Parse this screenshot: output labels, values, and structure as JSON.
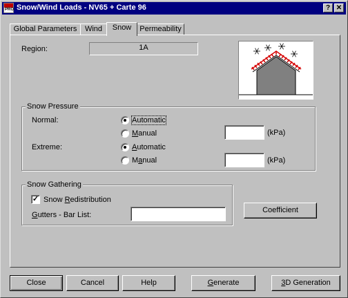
{
  "window": {
    "title": "Snow/Wind Loads - NV65 + Carte 96",
    "app_icon_text": "PRO",
    "help_btn": "?",
    "close_btn": "✕"
  },
  "tabs": [
    {
      "label": "Global Parameters",
      "active": false
    },
    {
      "label": "Wind",
      "active": false
    },
    {
      "label": "Snow",
      "active": true
    },
    {
      "label": "Permeability",
      "active": false
    }
  ],
  "region": {
    "label": "Region:",
    "value": "1A"
  },
  "illustration": {
    "icon": "snow-roof-illustration",
    "roof_color": "#d40000",
    "house_color": "#808080"
  },
  "snow_pressure": {
    "title": "Snow Pressure",
    "normal": {
      "label": "Normal:",
      "options": [
        "Automatic",
        "Manual"
      ],
      "selected": "Automatic",
      "value": "",
      "unit": "(kPa)"
    },
    "extreme": {
      "label": "Extreme:",
      "options": [
        "Automatic",
        "Manual"
      ],
      "selected": "Automatic",
      "value": "",
      "unit": "(kPa)"
    }
  },
  "snow_gathering": {
    "title": "Snow Gathering",
    "redistribution": {
      "label": "Snow Redistribution",
      "checked": true
    },
    "gutters": {
      "label": "Gutters - Bar List:",
      "value": ""
    }
  },
  "coefficient_button": "Coefficient",
  "footer_buttons": {
    "close": "Close",
    "cancel": "Cancel",
    "help": "Help",
    "generate": "Generate",
    "generation_3d": "3D Generation"
  }
}
